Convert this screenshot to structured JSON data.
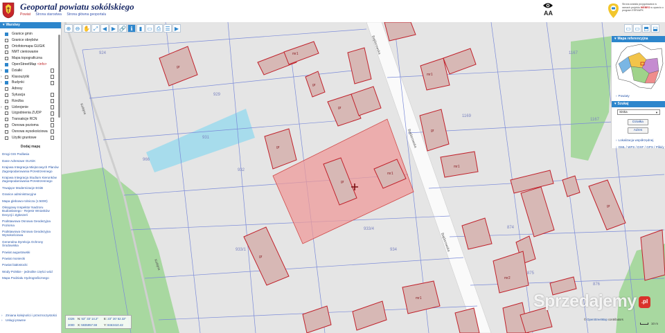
{
  "header": {
    "title": "Geoportal powiatu sokólskiego",
    "links": [
      "Powiat",
      "Strona starostwa",
      "Strona główna geoportalu"
    ],
    "active_link_index": 0,
    "font_size_label": "AA",
    "funding_text": "Strona została przygotowana w ramach projektu",
    "funding_highlight": "WEBEO",
    "funding_text2": "w oparciu o program ESRI/APK"
  },
  "sidebar": {
    "layers_title": "Warstwy",
    "layers": [
      {
        "label": "Granice gmin",
        "checked": true,
        "doc": false,
        "expand": false
      },
      {
        "label": "Granice obrębów",
        "checked": false,
        "doc": false,
        "expand": false
      },
      {
        "label": "Ortofotomapa GUGiK",
        "checked": false,
        "doc": false,
        "expand": false
      },
      {
        "label": "NMT cieniowanie",
        "checked": false,
        "doc": false,
        "expand": false
      },
      {
        "label": "Mapa topograficzna",
        "checked": false,
        "doc": false,
        "expand": false
      },
      {
        "label": "OpenStreetMap",
        "note": "<info>",
        "checked": true,
        "doc": false,
        "expand": false
      },
      {
        "label": "Działki",
        "checked": true,
        "doc": true,
        "expand": true
      },
      {
        "label": "Klasoużytki",
        "checked": false,
        "doc": true,
        "expand": true
      },
      {
        "label": "Budynki",
        "checked": true,
        "doc": true,
        "expand": true
      },
      {
        "label": "Adresy",
        "checked": false,
        "doc": false,
        "expand": false
      },
      {
        "label": "Sytuacja",
        "checked": false,
        "doc": true,
        "expand": false
      },
      {
        "label": "Rzeźba",
        "checked": false,
        "doc": true,
        "expand": false
      },
      {
        "label": "Uzbrojenie",
        "checked": false,
        "doc": true,
        "expand": true
      },
      {
        "label": "Uzgodnienia ZUDP",
        "checked": false,
        "doc": true,
        "expand": false
      },
      {
        "label": "Transakcje RCN",
        "checked": false,
        "doc": true,
        "expand": false
      },
      {
        "label": "Osnowa pozioma",
        "checked": false,
        "doc": true,
        "expand": false
      },
      {
        "label": "Osnowa wysokościowa",
        "checked": false,
        "doc": true,
        "expand": false
      },
      {
        "label": "Użytki gruntowe",
        "checked": false,
        "doc": true,
        "expand": false
      }
    ],
    "add_map_label": "Dodaj mapę",
    "services": [
      "Drogi GIS Podlasia",
      "Dane Adresowe GUGiK",
      "Krajowa Integracja Miejscowych Planów Zagospodarowania Przestrzennego",
      "Krajowa Integracja Studium Kierunków Zagospodarowania Przestrzennego",
      "Trwające Modernizacje EGiB",
      "Granice administracyjne",
      "Mapa glebowo-rolnicza (1:5000)",
      "Okręgowy Inspektor Nadzoru Budowlanego - Rejestr Wniosków Decyzji i Zgłoszeń",
      "Podstawowa Osnowa Geodezyjna Pozioma",
      "Podstawowa Osnowa Geodezyjna Wysokościowa",
      "Generalna Dyrekcja Ochrony Środowiska",
      "Powiat augustowski",
      "Powiat moniecki",
      "Powiat białostocki",
      "Wody Polskie - jednolite części wód",
      "Mapa Podziału Hydrograficznego"
    ],
    "footer_items": [
      "Zmiana kolejności i przezroczystości",
      "Usługi prawne"
    ]
  },
  "toolbar": {
    "left_tools": [
      "zoom-in-icon",
      "zoom-out-icon",
      "pan-icon",
      "zoom-extent-icon",
      "back-icon",
      "forward-icon",
      "link-icon",
      "info-icon",
      "legend-icon",
      "measure-icon",
      "print-icon",
      "layers-icon",
      "video-icon"
    ],
    "left_glyphs": [
      "⊕",
      "⊖",
      "✋",
      "⤢",
      "◀",
      "▶",
      "🔗",
      "ℹ",
      "▮",
      "▭",
      "⎙",
      "☰",
      "▶"
    ],
    "active_index": 7,
    "right_glyphs": [
      "▭",
      "▭",
      "⬒",
      "⬓"
    ]
  },
  "right_panel": {
    "reference_title": "Mapa referencyjna",
    "powiaty_link": "Powiaty",
    "search_title": "Szukaj",
    "search_select": "Siska",
    "btn_dzialki": "Działka",
    "btn_adres": "Adres",
    "loc_link": "Lokalizacja współrzędnej",
    "gml_link": "GML / WFS / DXF / GPX / Pliki/y"
  },
  "coords": {
    "crs_top": "4326",
    "crs_bottom": "2000",
    "n_label": "N:",
    "n_value": "53° 33' 14.2\"",
    "e_label": "E:",
    "e_value": "23° 20' 52.32\"",
    "x_label": "X:",
    "x_value": "5935957.59",
    "y_label": "Y:",
    "y_value": "8463410.42"
  },
  "map": {
    "street_labels": [
      "Bajdarowska",
      "Bajdarowska",
      "Bajdarowska",
      "Kolejna",
      "Kolejna"
    ],
    "parcel_labels": [
      "924",
      "929",
      "931",
      "932",
      "933/4",
      "934",
      "1169",
      "1167",
      "933/1",
      "966",
      "874",
      "875",
      "876",
      "1167"
    ],
    "building_labels": [
      "gr",
      "mr1",
      "gr",
      "gr",
      "gr",
      "gr",
      "mr1",
      "gr",
      "mr1",
      "gr",
      "mr1",
      "mr2",
      "gr",
      "mr1"
    ],
    "selected_color": "#ee9999",
    "green_color": "#a8d8a0",
    "water_color": "#a7dcec",
    "building_color": "#d7b8b5",
    "building_stroke": "#c0202a"
  },
  "watermark": {
    "text": "Sprzedajemy",
    "badge": ".pl"
  },
  "attribution": {
    "prefix": "©",
    "osm": "OpenStreetMap",
    "suffix": "contributors"
  },
  "scale": {
    "label": "10 m"
  }
}
